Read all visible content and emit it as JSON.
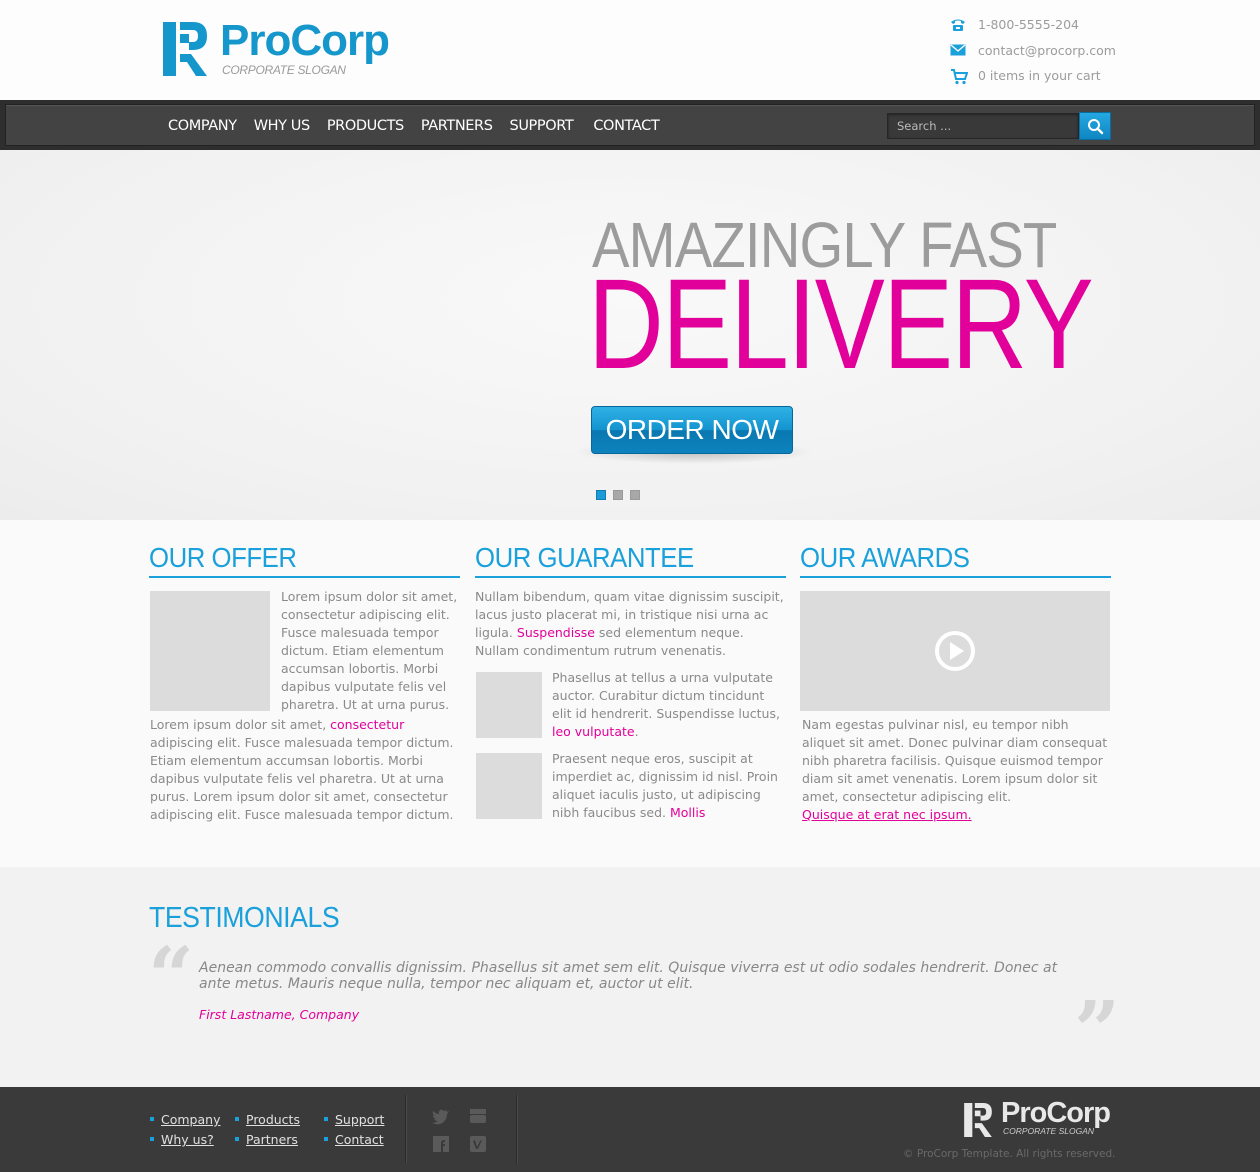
{
  "brand": {
    "name": "ProCorp",
    "slogan": "CORPORATE SLOGAN",
    "accent_color": "#1aa0db",
    "highlight_color": "#e2009b"
  },
  "header": {
    "phone": "1-800-5555-204",
    "email": "contact@procorp.com",
    "cart": "0 items in your cart",
    "icons": [
      "phone-icon",
      "mail-icon",
      "cart-icon"
    ]
  },
  "nav": {
    "items": [
      "COMPANY",
      "WHY US",
      "PRODUCTS",
      "PARTNERS",
      "SUPPORT",
      "CONTACT"
    ],
    "search_placeholder": "Search ...",
    "search_icon": "search-icon"
  },
  "hero": {
    "headline1": "AMAZINGLY FAST",
    "headline2": "DELIVERY",
    "button": "ORDER NOW",
    "slides": 3,
    "active_slide": 1
  },
  "offer": {
    "title": "OUR OFFER",
    "para_top": "Lorem ipsum dolor sit amet, consectetur adipiscing elit. Fusce malesuada tempor dictum. Etiam elementum accumsan lobortis. Morbi dapibus vulputate felis vel pharetra. Ut at urna purus.",
    "para_bottom_pre": "Lorem ipsum dolor sit amet, ",
    "para_bottom_link": "consectetur",
    "para_bottom_post": " adipiscing elit. Fusce malesuada tempor dictum. Etiam elementum accumsan lobortis. Morbi dapibus vulputate felis vel pharetra. Ut at urna purus. Lorem ipsum dolor sit amet, consectetur adipiscing elit. Fusce malesuada tempor dictum."
  },
  "guarantee": {
    "title": "OUR GUARANTEE",
    "intro_pre": "Nullam bibendum, quam vitae dignissim suscipit, lacus justo placerat mi, in tristique nisi urna ac ligula. ",
    "intro_link": "Suspendisse",
    "intro_post": " sed elementum neque. Nullam condimentum rutrum venenatis.",
    "item1_pre": "Phasellus at tellus a urna vulputate auctor. Curabitur dictum tincidunt elit id hendrerit. Suspendisse luctus, ",
    "item1_link": "leo vulputate",
    "item1_post": ".",
    "item2_pre": "Praesent neque eros, suscipit at imperdiet ac, dignissim id nisl. Proin aliquet iaculis justo, ut adipiscing nibh faucibus sed. ",
    "item2_link": "Mollis"
  },
  "awards": {
    "title": "OUR AWARDS",
    "video_icon": "play-icon",
    "text": "Nam egestas pulvinar nisl, eu tempor nibh aliquet sit amet. Donec pulvinar diam consequat nibh pharetra facilisis. Quisque euismod tempor diam sit amet venenatis. Lorem ipsum dolor sit amet, consectetur adipiscing elit.",
    "link": "Quisque at erat nec ipsum."
  },
  "testimonials": {
    "title": "TESTIMONIALS",
    "quote": "Aenean commodo convallis dignissim. Phasellus sit amet sem elit. Quisque viverra est ut odio sodales hendrerit. Donec at ante metus. Mauris neque nulla, tempor nec aliquam et, auctor ut elit.",
    "author": "First Lastname, Company",
    "open_mark": "“",
    "close_mark": "”"
  },
  "footer": {
    "links": [
      "Company",
      "Why us?",
      "Products",
      "Partners",
      "Support",
      "Contact"
    ],
    "social": [
      "twitter-icon",
      "youtube-icon",
      "facebook-icon",
      "vimeo-icon"
    ],
    "copyright": "© ProCorp Template. All rights reserved."
  }
}
